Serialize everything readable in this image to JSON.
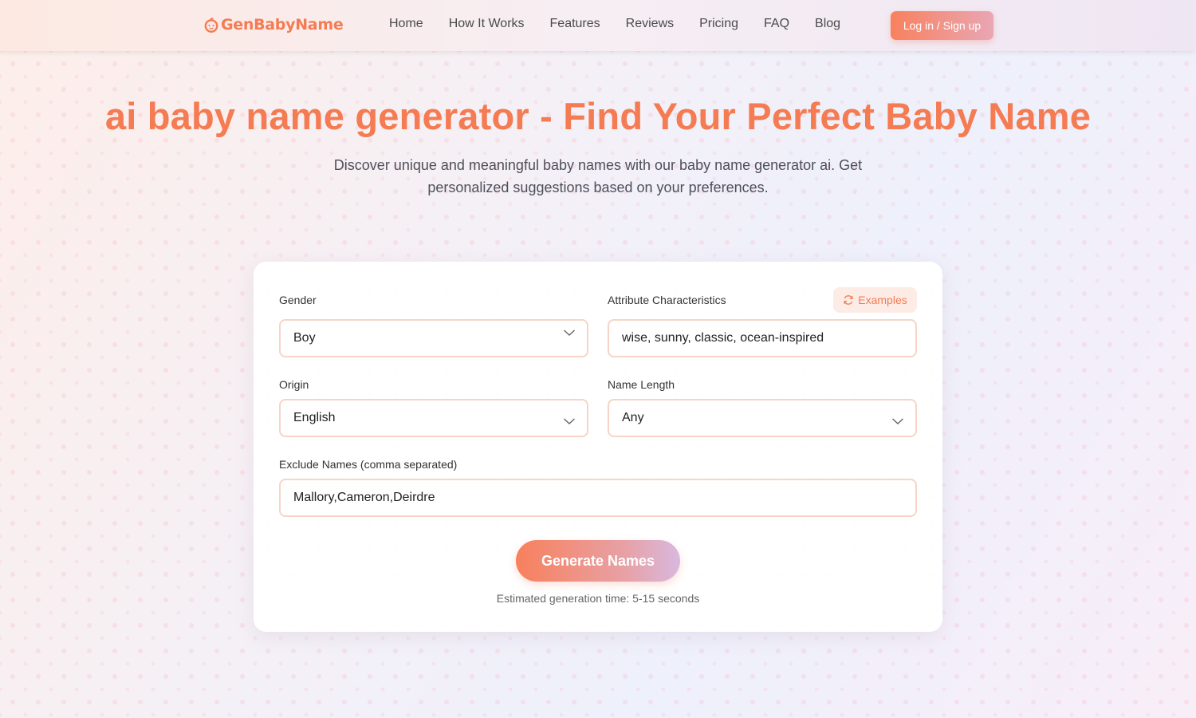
{
  "header": {
    "logo_text": "GenBabyName",
    "nav": [
      "Home",
      "How It Works",
      "Features",
      "Reviews",
      "Pricing",
      "FAQ",
      "Blog"
    ],
    "login_label": "Log in / Sign up"
  },
  "hero": {
    "title": "ai baby name generator - Find Your Perfect Baby Name",
    "subtitle": "Discover unique and meaningful baby names with our baby name generator ai. Get personalized suggestions based on your preferences."
  },
  "form": {
    "gender": {
      "label": "Gender",
      "value": "Boy"
    },
    "attributes": {
      "label": "Attribute Characteristics",
      "value": "wise, sunny, classic, ocean-inspired",
      "examples_label": "Examples"
    },
    "origin": {
      "label": "Origin",
      "value": "English"
    },
    "length": {
      "label": "Name Length",
      "value": "Any"
    },
    "exclude": {
      "label": "Exclude Names (comma separated)",
      "value": "Mallory,Cameron,Deirdre"
    },
    "generate_label": "Generate Names",
    "estimate": "Estimated generation time: 5-15 seconds"
  },
  "colors": {
    "accent": "#f47b52",
    "field_border": "#f7d4c6",
    "examples_bg": "#fdece6"
  },
  "icons": {
    "logo": "baby-face-icon",
    "examples": "refresh-icon",
    "select": "chevron-down-icon"
  }
}
